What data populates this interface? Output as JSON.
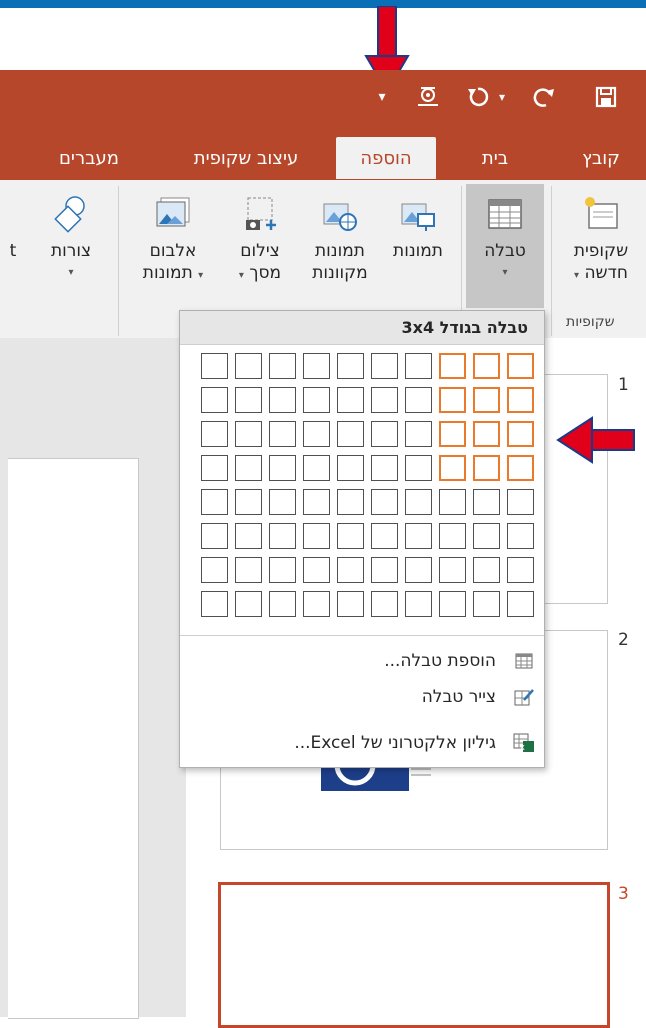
{
  "quick_access": {
    "customize_glyph": "▾",
    "icons": [
      "save-icon",
      "redo-icon",
      "undo-icon",
      "presenter-icon"
    ]
  },
  "tabs": [
    {
      "label": "קובץ",
      "active": false
    },
    {
      "label": "בית",
      "active": false
    },
    {
      "label": "הוספה",
      "active": true
    },
    {
      "label": "עיצוב שקופית",
      "active": false
    },
    {
      "label": "מעברים",
      "active": false
    }
  ],
  "ribbon": {
    "new_slide": {
      "line1": "שקופית",
      "line2": "חדשה"
    },
    "table": {
      "label": "טבלה"
    },
    "pictures": {
      "label": "תמונות"
    },
    "online_pictures": {
      "line1": "תמונות",
      "line2": "מקוונות"
    },
    "screenshot": {
      "line1": "צילום",
      "line2": "מסך"
    },
    "photo_album": {
      "line1": "אלבום",
      "line2": "תמונות"
    },
    "shapes": {
      "label": "צורות"
    },
    "cut_text": "t",
    "group_slides": "שקופיות"
  },
  "table_dropdown": {
    "header": "טבלה בגודל 3x4",
    "columns": 10,
    "rows": 8,
    "highlight_cols": 3,
    "highlight_rows": 4,
    "items": [
      {
        "label": "הוספת טבלה...",
        "icon": "insert-table-icon"
      },
      {
        "label": "צייר טבלה",
        "icon": "draw-table-icon"
      },
      {
        "label": "גיליון אלקטרוני של Excel...",
        "icon": "excel-sheet-icon"
      }
    ]
  },
  "slides": [
    {
      "number": "1"
    },
    {
      "number": "2"
    },
    {
      "number": "3",
      "selected": true
    }
  ],
  "colors": {
    "accent": "#b7472a",
    "highlight": "#e97a2b",
    "annotation_arrow": "#e1001a"
  }
}
